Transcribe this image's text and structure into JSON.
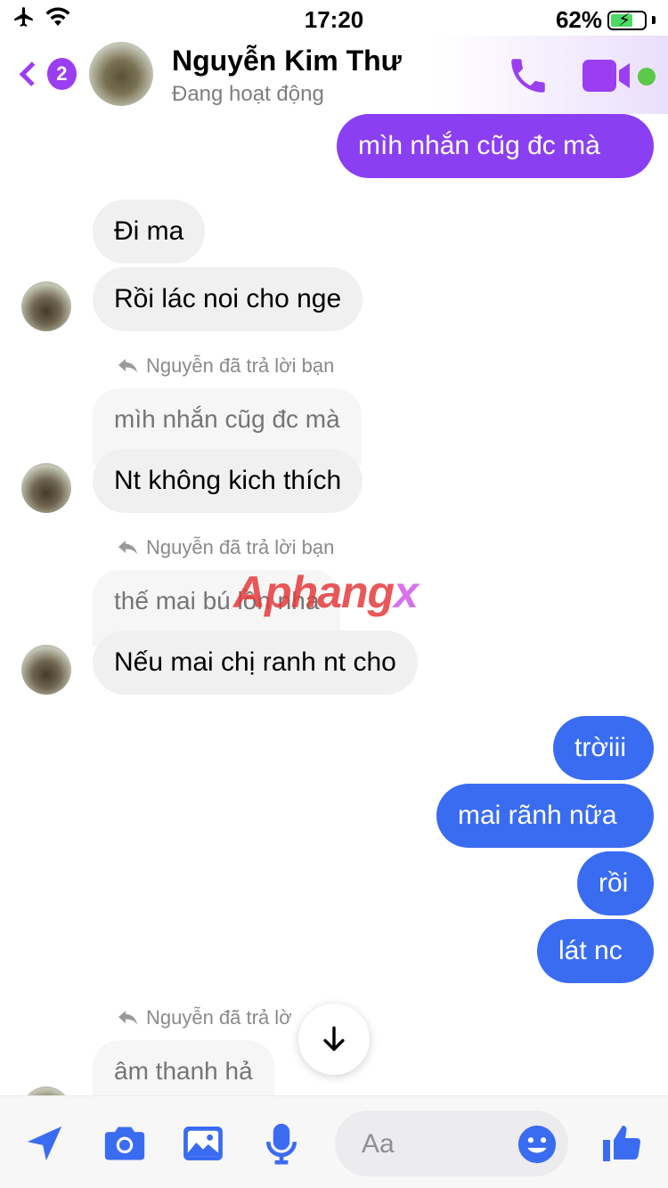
{
  "status_bar": {
    "time": "17:20",
    "battery": "62%"
  },
  "header": {
    "back_badge": "2",
    "contact_name": "Nguyễn Kim Thư",
    "contact_status": "Đang hoạt động"
  },
  "messages": {
    "m1": "mìh nhắn cũg đc mà",
    "m2": "Đi ma",
    "m3": "Rồi lác noi cho nge",
    "reply1_label": "Nguyễn đã trả lời bạn",
    "reply1_quote": "mìh nhắn cũg đc mà",
    "m4": "Nt không kich thích",
    "reply2_label": "Nguyễn đã trả lời bạn",
    "reply2_quote": "thế mai bú lồn nha",
    "m5": "Nếu mai chị ranh nt cho",
    "m6": "trờiii",
    "m7": "mai rãnh nữa",
    "m8": "rồi",
    "m9": "lát nc",
    "reply3_label": "Nguyễn đã trả lờ",
    "reply3_quote": "âm thanh hả"
  },
  "watermark": {
    "main": "Aphang",
    "suffix": "x"
  },
  "composer": {
    "placeholder": "Aa"
  },
  "colors": {
    "accent_purple": "#8b3ff2",
    "accent_blue": "#3a6cf2",
    "online": "#5bc84a",
    "incoming": "#f0f0f0"
  },
  "icons": [
    "airplane-icon",
    "wifi-icon",
    "battery-icon",
    "phone-icon",
    "video-icon",
    "arrow-down-icon",
    "location-icon",
    "camera-icon",
    "image-icon",
    "microphone-icon",
    "emoji-icon",
    "thumbs-up-icon"
  ]
}
